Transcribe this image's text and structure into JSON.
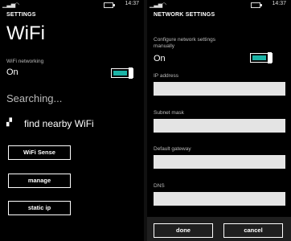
{
  "left": {
    "status": {
      "time": "14:37"
    },
    "heading": "SETTINGS",
    "title": "WiFi",
    "wifi_networking_label": "WiFi networking",
    "wifi_networking_value": "On",
    "searching": "Searching...",
    "find_nearby": "find nearby WiFi",
    "buttons": {
      "wifi_sense": "WiFi Sense",
      "manage": "manage",
      "static_ip": "static ip"
    }
  },
  "right": {
    "status": {
      "time": "14:37"
    },
    "heading": "NETWORK SETTINGS",
    "configure_label": "Configure network settings manually",
    "configure_value": "On",
    "fields": {
      "ip_address": {
        "label": "IP address",
        "value": ""
      },
      "subnet_mask": {
        "label": "Subnet mask",
        "value": ""
      },
      "default_gateway": {
        "label": "Default gateway",
        "value": ""
      },
      "dns": {
        "label": "DNS",
        "value": ""
      }
    },
    "appbar": {
      "done": "done",
      "cancel": "cancel"
    }
  },
  "colors": {
    "accent": "#1bb3a6",
    "background": "#000000",
    "field": "#e4e4e4"
  },
  "icons": {
    "signal": "signal-icon",
    "wifi": "wifi-icon",
    "battery": "battery-icon",
    "find": "signal-search-icon"
  }
}
